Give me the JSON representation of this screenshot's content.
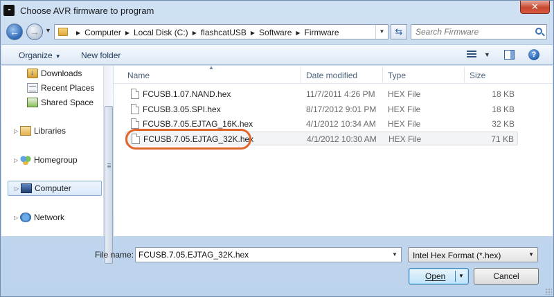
{
  "window": {
    "title": "Choose AVR firmware to program",
    "close_glyph": "✕"
  },
  "address": {
    "crumbs": [
      "Computer",
      "Local Disk (C:)",
      "flashcatUSB",
      "Software",
      "Firmware"
    ]
  },
  "search": {
    "placeholder": "Search Firmware"
  },
  "toolbar": {
    "organize_label": "Organize",
    "new_folder_label": "New folder"
  },
  "navigation": {
    "items": [
      {
        "label": "Downloads",
        "icon": "downloads-icon"
      },
      {
        "label": "Recent Places",
        "icon": "recent-places-icon"
      },
      {
        "label": "Shared Space",
        "icon": "shared-space-icon"
      },
      {
        "label": "Libraries",
        "icon": "libraries-icon"
      },
      {
        "label": "Homegroup",
        "icon": "homegroup-icon"
      },
      {
        "label": "Computer",
        "icon": "computer-icon",
        "selected": true
      },
      {
        "label": "Network",
        "icon": "network-icon"
      }
    ]
  },
  "columns": {
    "name": "Name",
    "date": "Date modified",
    "type": "Type",
    "size": "Size"
  },
  "files": [
    {
      "name": "FCUSB.1.07.NAND.hex",
      "date": "11/7/2011 4:26 PM",
      "type": "HEX File",
      "size": "18 KB"
    },
    {
      "name": "FCUSB.3.05.SPI.hex",
      "date": "8/17/2012 9:01 PM",
      "type": "HEX File",
      "size": "18 KB"
    },
    {
      "name": "FCUSB.7.05.EJTAG_16K.hex",
      "date": "4/1/2012 10:34 AM",
      "type": "HEX File",
      "size": "32 KB"
    },
    {
      "name": "FCUSB.7.05.EJTAG_32K.hex",
      "date": "4/1/2012 10:30 AM",
      "type": "HEX File",
      "size": "71 KB",
      "selected": true
    }
  ],
  "footer": {
    "file_name_label": "File name:",
    "file_name_value": "FCUSB.7.05.EJTAG_32K.hex",
    "filter_value": "Intel Hex Format (*.hex)",
    "open_label": "Open",
    "cancel_label": "Cancel"
  },
  "colors": {
    "highlight_annotation": "#e2632a",
    "selected_nav_border": "#84acdd"
  }
}
